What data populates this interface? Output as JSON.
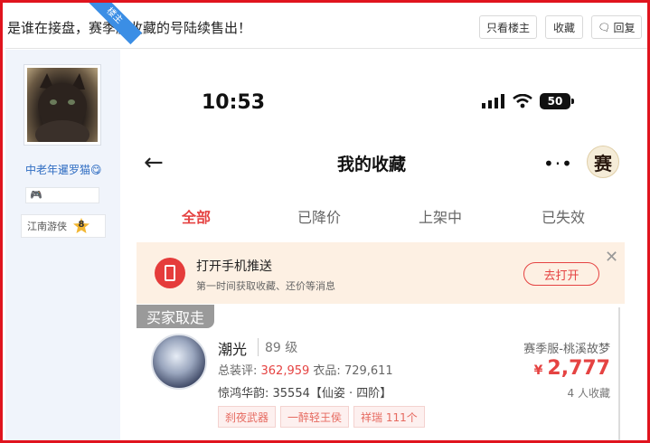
{
  "thread": {
    "title": "是谁在接盘，赛季服收藏的号陆续售出！",
    "only_op_label": "只看楼主",
    "favorite_label": "收藏",
    "reply_label": "回复"
  },
  "author": {
    "op_badge": "楼主",
    "name": "中老年暹罗猫😋",
    "rank_title": "江南游侠",
    "level": "8"
  },
  "phone": {
    "time": "10:53",
    "battery": "50",
    "page_title": "我的收藏",
    "brand_char": "赛",
    "tabs": [
      "全部",
      "已降价",
      "上架中",
      "已失效"
    ],
    "active_tab": 0,
    "banner": {
      "title": "打开手机推送",
      "subtitle": "第一时间获取收藏、还价等消息",
      "button": "去打开"
    },
    "item": {
      "status_tag": "买家取走",
      "name": "潮光",
      "level": "89 级",
      "server": "赛季服-桃溪故梦",
      "stats_label_1": "总装评: ",
      "stats_value_1": "362,959",
      "stats_label_2": " 衣品: ",
      "stats_value_2": "729,611",
      "currency": "¥",
      "price": "2,777",
      "attribute": "惊鸿华韵: 35554【仙姿 · 四阶】",
      "favorites": "4 人收藏",
      "tags": [
        "刹夜武器",
        "一醉轻王侯",
        "祥瑞 111个"
      ]
    }
  },
  "colors": {
    "frame": "#e0141e",
    "accent": "#e54342",
    "link": "#2f6dc2",
    "op_badge": "#3b8ee5"
  }
}
